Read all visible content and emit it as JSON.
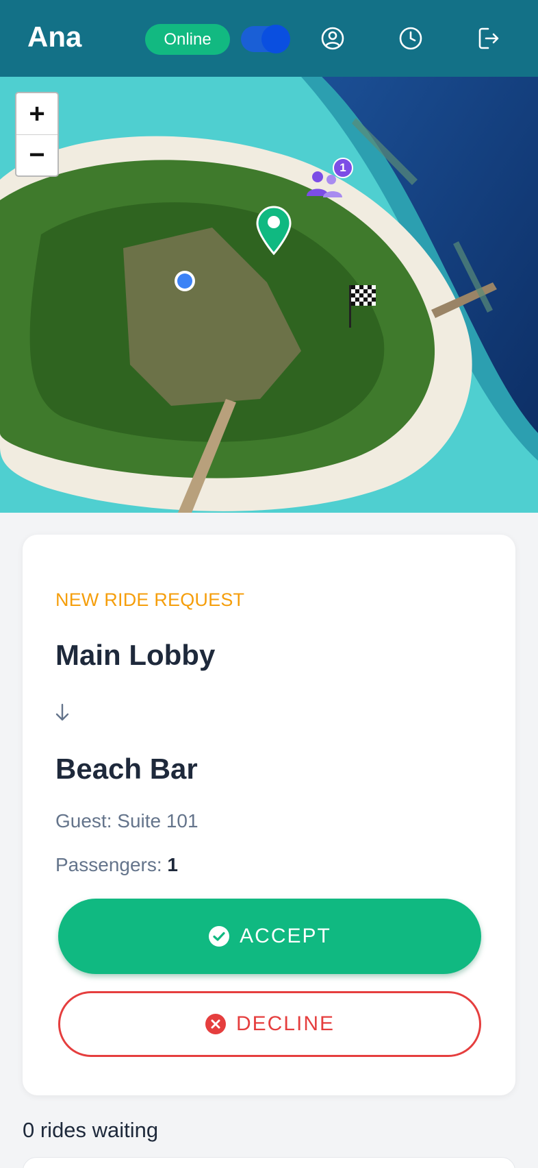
{
  "header": {
    "driver_name": "Ana",
    "status_label": "Online",
    "online_toggle_on": true,
    "icons": [
      "profile-icon",
      "history-icon",
      "logout-icon"
    ]
  },
  "map": {
    "zoom_in_label": "+",
    "zoom_out_label": "−",
    "passenger_group_count": "1",
    "markers": [
      "pickup-pin",
      "driver-location-dot",
      "destination-flag",
      "passenger-group"
    ]
  },
  "request": {
    "label": "NEW RIDE REQUEST",
    "pickup": "Main Lobby",
    "dropoff": "Beach Bar",
    "guest": "Guest: Suite 101",
    "passengers_label": "Passengers:",
    "passengers_value": "1",
    "accept_label": "ACCEPT",
    "decline_label": "DECLINE"
  },
  "queue": {
    "waiting_text": "0 rides waiting"
  },
  "colors": {
    "header": "#137187",
    "online": "#12b981",
    "accent_orange": "#f59e0b",
    "accept": "#10b981",
    "decline": "#e53e3e",
    "passenger_marker": "#7c4de6",
    "pickup_pin": "#10b981"
  }
}
